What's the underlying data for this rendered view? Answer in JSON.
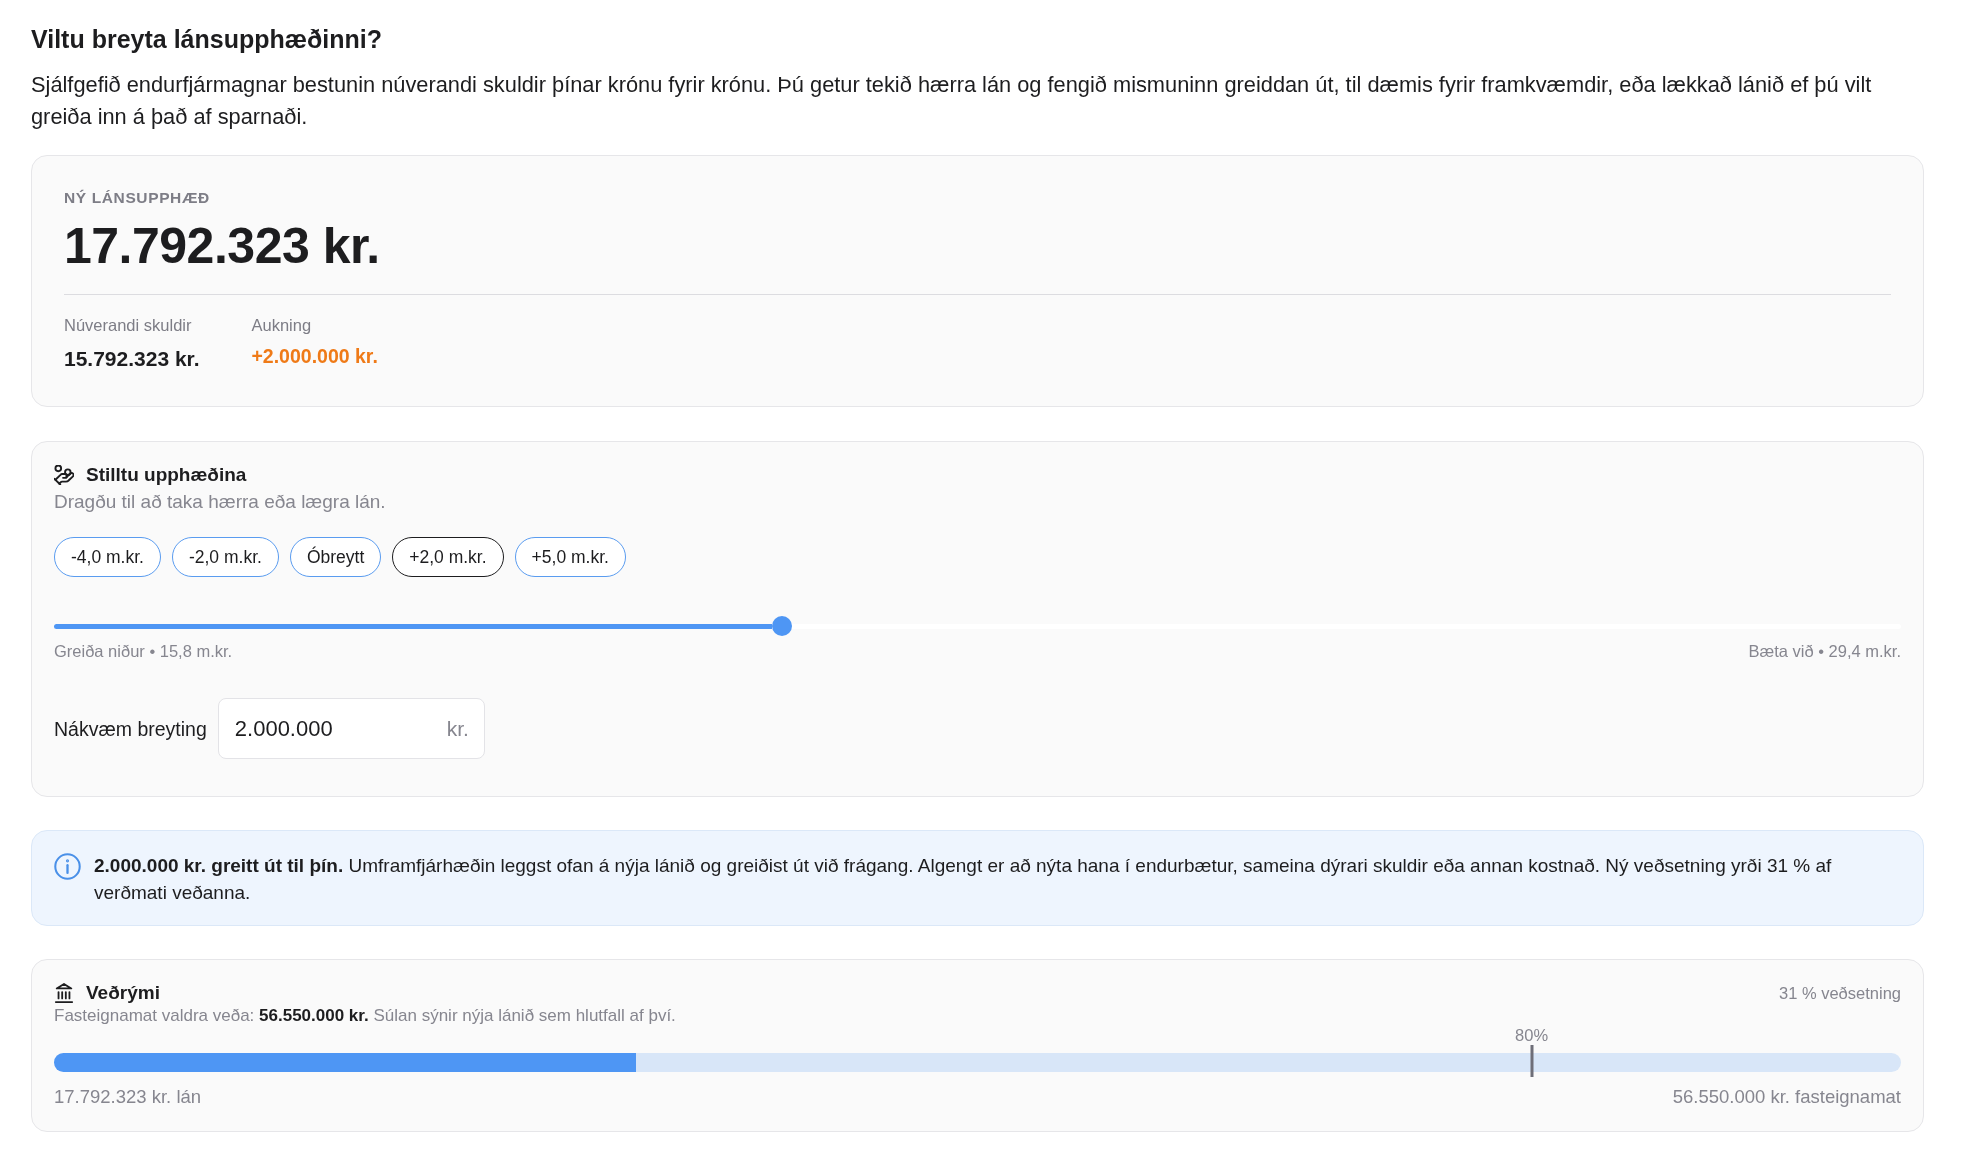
{
  "heading": "Viltu breyta lánsupphæðinni?",
  "intro": "Sjálfgefið endurfjármagnar bestunin núverandi skuldir þínar krónu fyrir krónu. Þú getur tekið hærra lán og fengið mismuninn greiddan út, til dæmis fyrir framkvæmdir, eða lækkað lánið ef þú vilt greiða inn á það af sparnaði.",
  "summary": {
    "label": "NÝ LÁNSUPPHÆÐ",
    "amount": "17.792.323 kr.",
    "stats": [
      {
        "label": "Núverandi skuldir",
        "value": "15.792.323 kr.",
        "kind": "plain"
      },
      {
        "label": "Aukning",
        "value": "+2.000.000 kr.",
        "kind": "increase"
      }
    ]
  },
  "adjust": {
    "title": "Stilltu upphæðina",
    "subtitle": "Dragðu til að taka hærra eða lægra lán.",
    "presets": [
      {
        "label": "-4,0 m.kr.",
        "selected": false
      },
      {
        "label": "-2,0 m.kr.",
        "selected": false
      },
      {
        "label": "Óbreytt",
        "selected": false
      },
      {
        "label": "+2,0 m.kr.",
        "selected": true
      },
      {
        "label": "+5,0 m.kr.",
        "selected": false
      }
    ],
    "slider": {
      "level": 0.394,
      "min_label": "Greiða niður • 15,8 m.kr.",
      "max_label": "Bæta við • 29,4 m.kr."
    },
    "exact": {
      "label": "Nákvæm breyting",
      "value": "2.000.000",
      "unit": "kr."
    }
  },
  "notice": {
    "text": "**2.000.000 kr. greitt út til þín.** Umframfjárhæðin leggst ofan á nýja lánið og greiðist út við frágang. Algengt er að nýta hana í endurbætur, sameina dýrari skuldir eða annan kostnað. Ný veðsetning yrði 31 % af verðmati veðanna."
  },
  "collateral": {
    "title": "Veðrými",
    "ratio": "31 % veðsetning",
    "note": "Fasteignamat valdra veða: **56.550.000 kr.** Súlan sýnir nýja lánið sem hlutfall af því.",
    "bar": {
      "level": 0.315
    },
    "marker": {
      "label": "80%",
      "level": 0.8
    },
    "loan_label": "17.792.323 kr. lán",
    "value_label": "56.550.000 kr. fasteignamat"
  }
}
